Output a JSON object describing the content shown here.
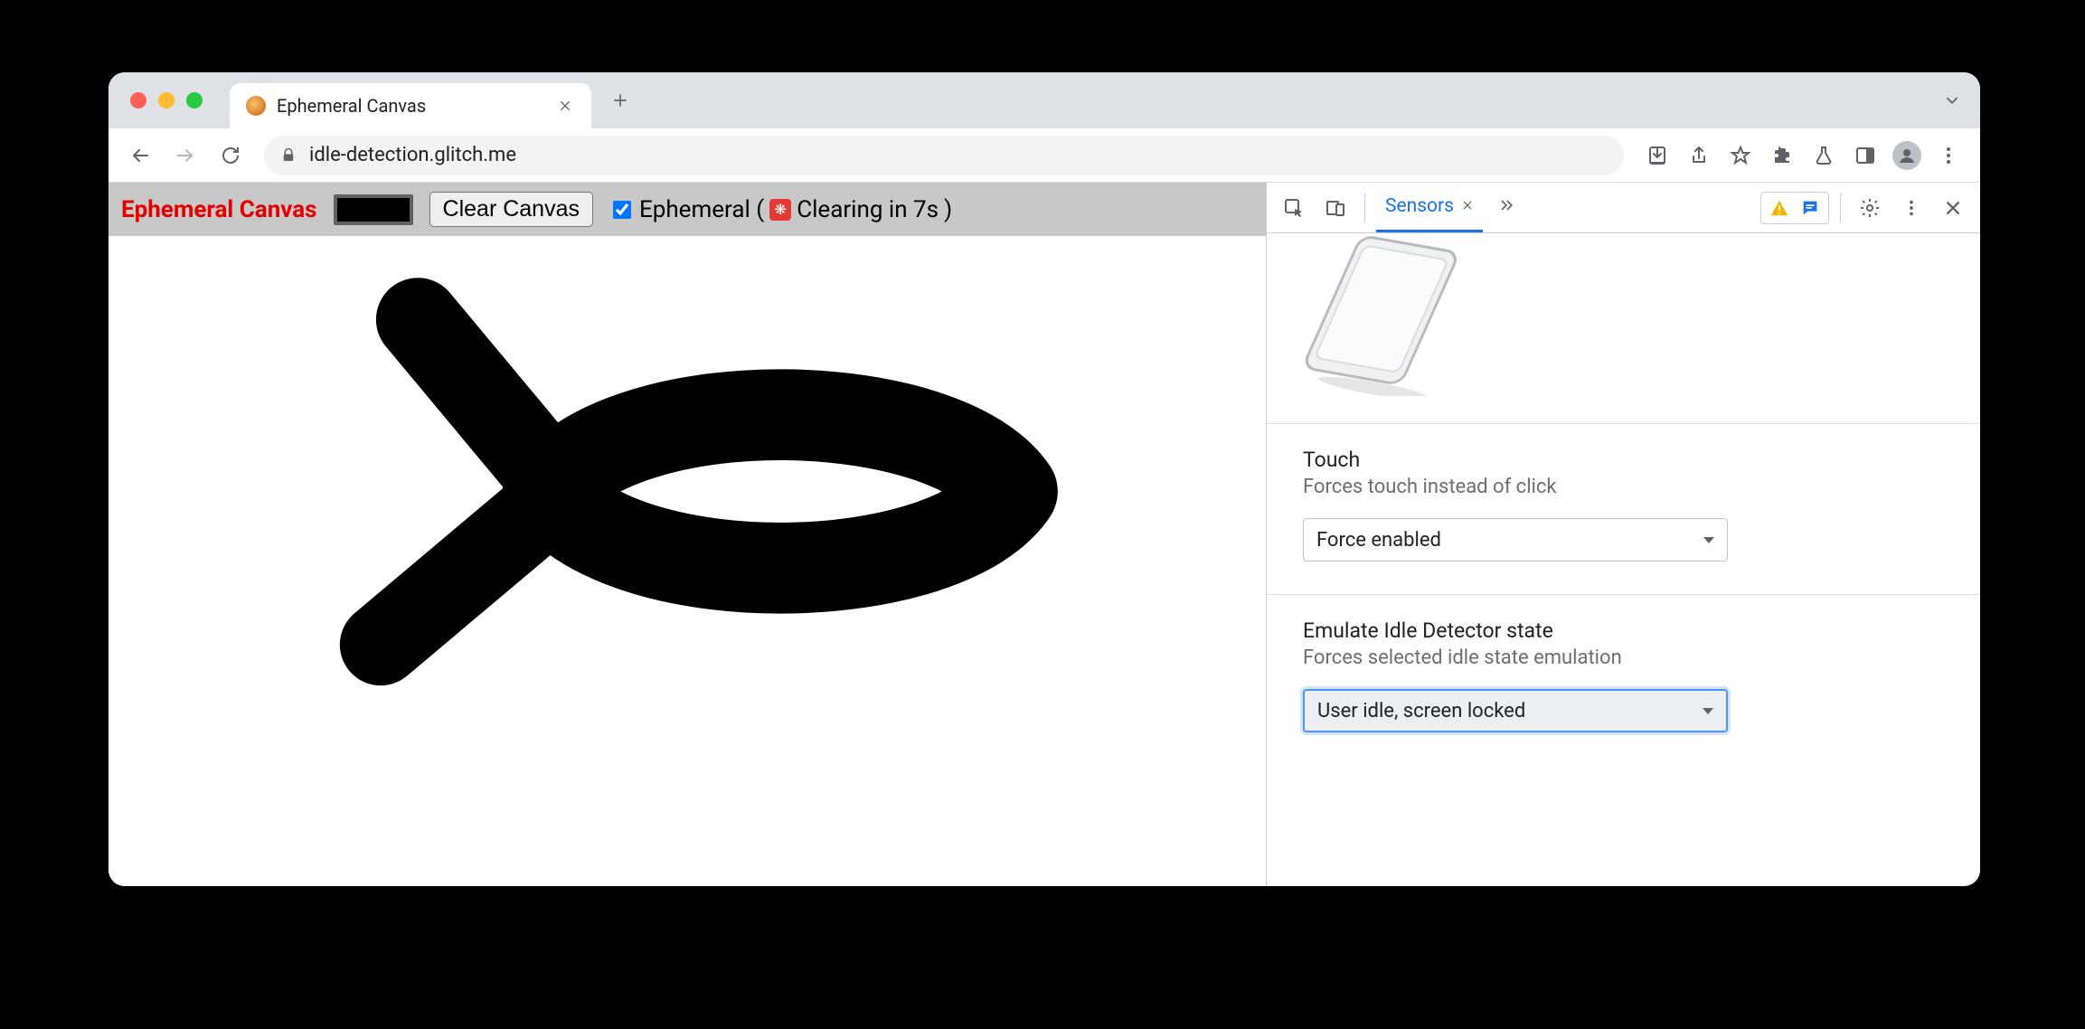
{
  "browser": {
    "tab_title": "Ephemeral Canvas",
    "url": "idle-detection.glitch.me"
  },
  "app": {
    "title": "Ephemeral Canvas",
    "clear_button": "Clear Canvas",
    "ephemeral_checked": true,
    "ephemeral_label_prefix": "Ephemeral (",
    "ephemeral_countdown": "Clearing in 7s",
    "ephemeral_label_suffix": ")",
    "brush_color": "#000000"
  },
  "devtools": {
    "active_tab": "Sensors",
    "touch": {
      "label": "Touch",
      "sub": "Forces touch instead of click",
      "value": "Force enabled"
    },
    "idle": {
      "label": "Emulate Idle Detector state",
      "sub": "Forces selected idle state emulation",
      "value": "User idle, screen locked"
    }
  }
}
